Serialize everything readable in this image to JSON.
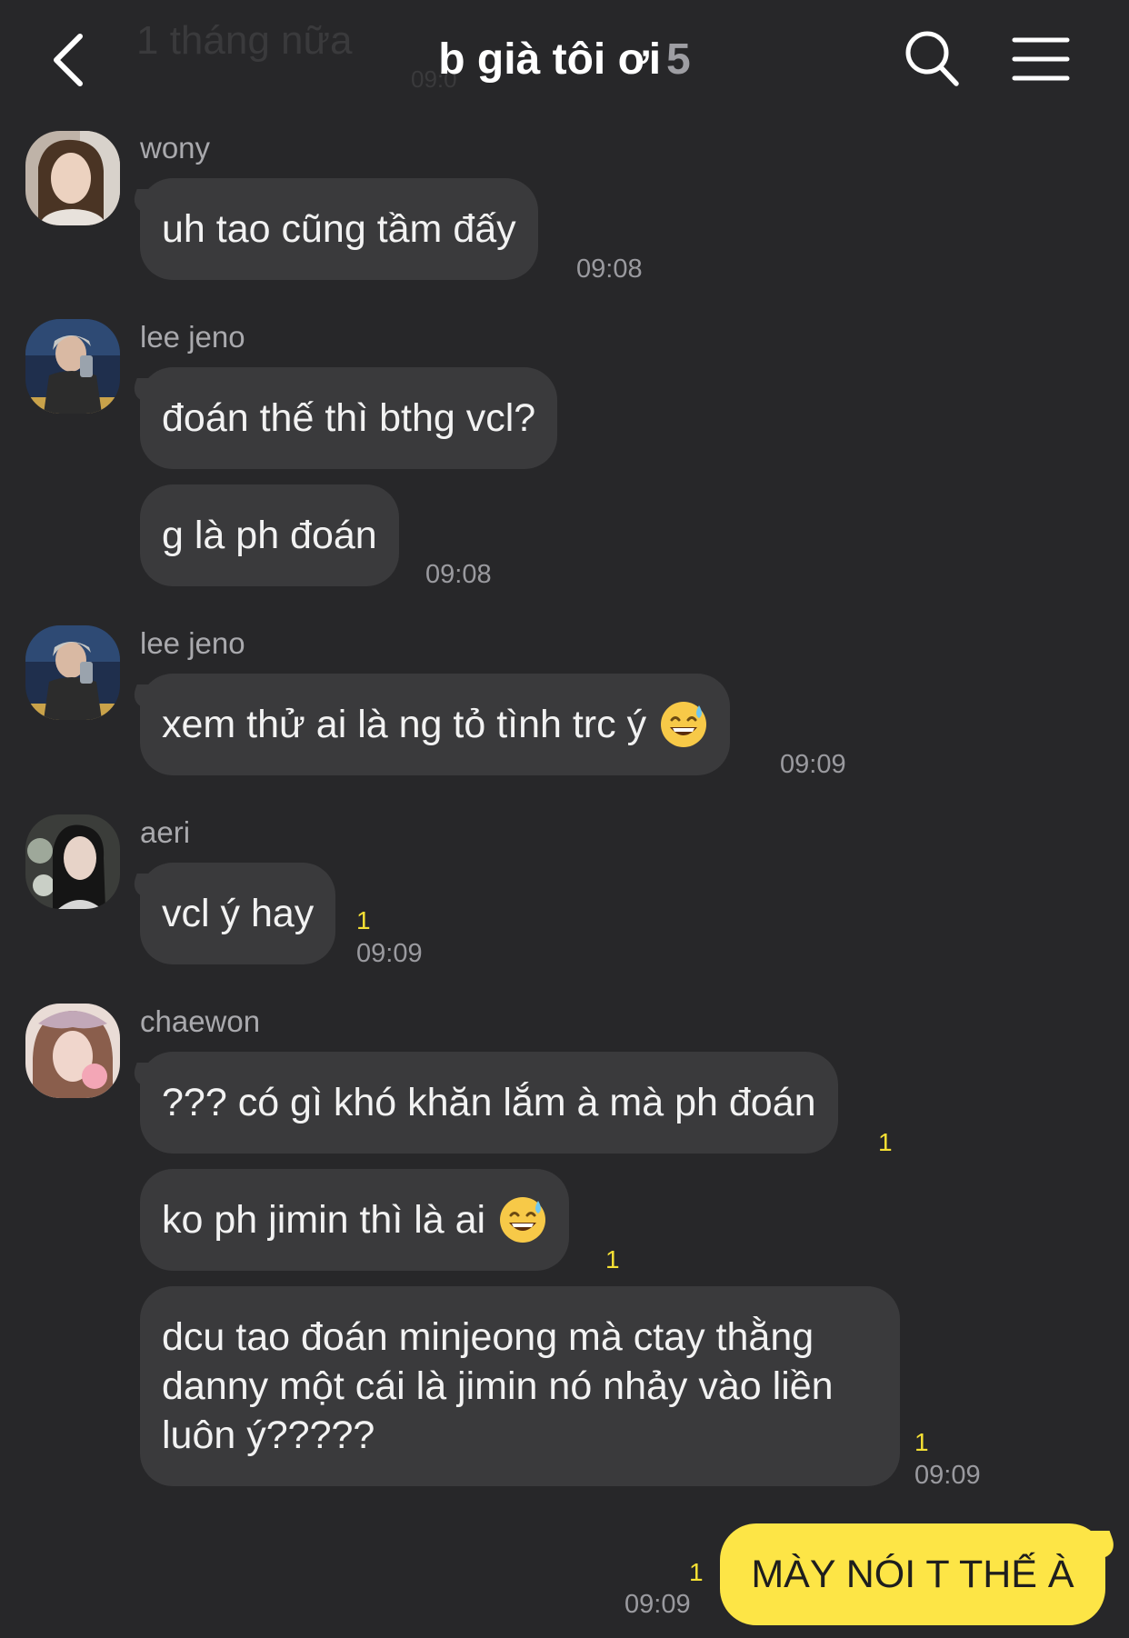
{
  "header": {
    "ghost_text": "1 tháng nữa",
    "ghost_time": "09:0",
    "title": "b già tôi ơi",
    "member_count": "5"
  },
  "messages": [
    {
      "sender": "wony",
      "bubbles": [
        "uh tao cũng tầm đấy"
      ],
      "time": "09:08"
    },
    {
      "sender": "lee jeno",
      "bubbles": [
        "đoán thế thì bthg vcl?",
        "g là ph đoán"
      ],
      "time": "09:08"
    },
    {
      "sender": "lee jeno",
      "bubbles": [
        "xem thử ai là ng tỏ tình trc ý"
      ],
      "time": "09:09",
      "emoji": "sweat-smile-emoji"
    },
    {
      "sender": "aeri",
      "bubbles": [
        "vcl ý hay"
      ],
      "unread": "1",
      "time": "09:09"
    },
    {
      "sender": "chaewon",
      "bubbles": [
        "??? có gì khó khăn lắm à mà ph đoán",
        "ko ph jimin thì là ai",
        "dcu tao đoán minjeong mà ctay thằng danny một cái là jimin nó nhảy vào liền luôn ý?????"
      ],
      "unreads": [
        "1",
        "1",
        "1"
      ],
      "time": "09:09",
      "emoji": "sweat-smile-emoji"
    }
  ],
  "my_message": {
    "text": "MÀY NÓI T THẾ À",
    "unread": "1",
    "time": "09:09"
  },
  "colors": {
    "background": "#272729",
    "bubble": "#3a3a3c",
    "my_bubble": "#fde546",
    "unread": "#f5e034",
    "time": "#9a9a9f"
  }
}
